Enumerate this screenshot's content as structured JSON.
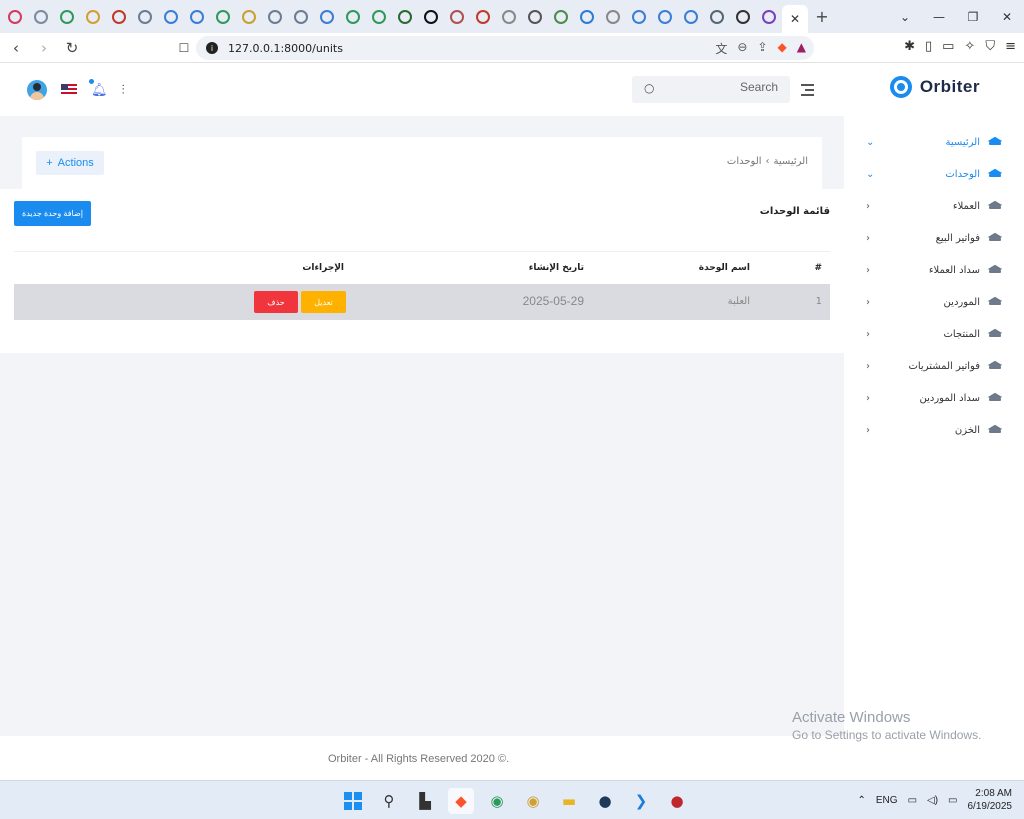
{
  "browser": {
    "tab_favicon_colors": [
      "#d33a5c",
      "#7a8aa0",
      "#2e9a5a",
      "#d0a030",
      "#c0392b",
      "#6b7c93",
      "#3b7dd8",
      "#3b7dd8",
      "#2e9a5a",
      "#c9a030",
      "#6b7c93",
      "#6b7c93",
      "#3b7dd8",
      "#2e9a5a",
      "#2e9a5a",
      "#2a6a30",
      "#111111",
      "#b05050",
      "#c0392b",
      "#888888",
      "#555555",
      "#4a8c4a",
      "#2e7bd8",
      "#888888",
      "#3b7dd8",
      "#3b7dd8",
      "#3b7dd8",
      "#556677",
      "#333333",
      "#7b3fbf"
    ],
    "active_tab_close": "✕",
    "new_tab": "+",
    "url": "127.0.0.1:8000/units"
  },
  "header": {
    "brand": "Orbiter",
    "search_placeholder": "Search"
  },
  "sidebar": {
    "items": [
      {
        "label": "الرئيسية",
        "active": true
      },
      {
        "label": "الوحدات",
        "active": true
      },
      {
        "label": "العملاء",
        "active": false
      },
      {
        "label": "فواتير البيع",
        "active": false
      },
      {
        "label": "سداد العملاء",
        "active": false
      },
      {
        "label": "الموردين",
        "active": false
      },
      {
        "label": "المنتجات",
        "active": false
      },
      {
        "label": "فواتير المشتريات",
        "active": false
      },
      {
        "label": "سداد الموردين",
        "active": false
      },
      {
        "label": "الخزن",
        "active": false
      }
    ]
  },
  "breadcrumb": {
    "home": "الرئيسية",
    "separator": "›",
    "current": "الوحدات"
  },
  "actions_label": "Actions",
  "list": {
    "title": "قائمة الوحدات",
    "add_button": "إضافة وحدة جديدة",
    "columns": {
      "index": "#",
      "name": "اسم الوحدة",
      "created": "تاريخ الإنشاء",
      "actions": "الإجراءات"
    },
    "rows": [
      {
        "index": "1",
        "name": "العلبة",
        "created": "2025-05-29",
        "edit": "تعديل",
        "delete": "حذف"
      }
    ]
  },
  "footer": {
    "text": "Orbiter - All Rights Reserved 2020 ©."
  },
  "watermark": {
    "line1": "Activate Windows",
    "line2": "Go to Settings to activate Windows."
  },
  "taskbar": {
    "lang": "ENG",
    "time": "2:08 AM",
    "date": "6/19/2025"
  }
}
